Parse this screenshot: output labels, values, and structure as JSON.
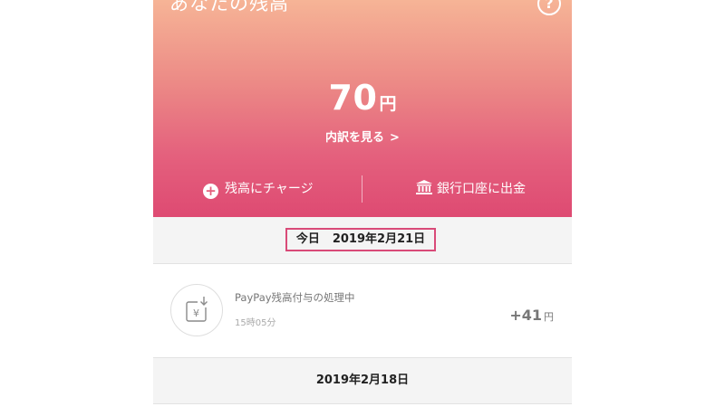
{
  "header": {
    "title": "あなたの残高",
    "help_symbol": "?"
  },
  "balance": {
    "amount": "70",
    "unit": "円",
    "breakdown_label": "内訳を見る",
    "breakdown_chevron": ">"
  },
  "actions": {
    "charge_label": "残高にチャージ",
    "charge_icon": "plus-circle-icon",
    "withdraw_label": "銀行口座に出金",
    "withdraw_icon": "bank-icon"
  },
  "history": {
    "today_label": "今日",
    "today_date": "2019年2月21日",
    "transactions": [
      {
        "title": "PayPay残高付与の処理中",
        "time": "15時05分",
        "amount": "+41",
        "unit": "円",
        "icon": "yen-receive-icon"
      }
    ],
    "previous_date": "2019年2月18日"
  },
  "colors": {
    "gradient_top": "#f6b496",
    "gradient_bottom": "#de4a72",
    "highlight_border": "#d94a78"
  }
}
